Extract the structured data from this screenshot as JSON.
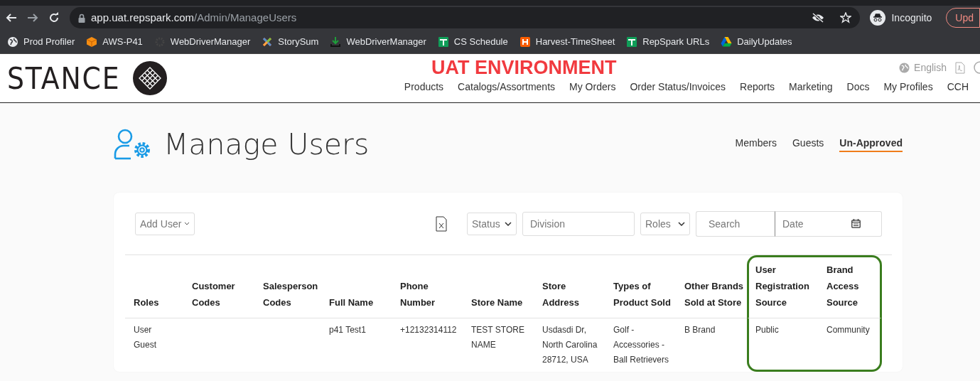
{
  "browser": {
    "url_host": "app.uat.repspark.com",
    "url_path": "/Admin/ManageUsers",
    "profile": "Incognito",
    "update_button": "Upd"
  },
  "bookmarks": [
    {
      "label": "Prod Profiler",
      "kind": "globe"
    },
    {
      "label": "AWS-P41",
      "kind": "cube"
    },
    {
      "label": "WebDriverManager",
      "kind": "gear"
    },
    {
      "label": "StorySum",
      "kind": "joomla"
    },
    {
      "label": "WebDriverManager",
      "kind": "download"
    },
    {
      "label": "CS Schedule",
      "kind": "sheet"
    },
    {
      "label": "Harvest-TimeSheet",
      "kind": "harvest"
    },
    {
      "label": "RepSpark URLs",
      "kind": "sheet"
    },
    {
      "label": "DailyUpdates",
      "kind": "drive"
    }
  ],
  "header": {
    "logo": "STANCE",
    "environment": "UAT ENVIRONMENT",
    "language": "English",
    "nav": [
      "Products",
      "Catalogs/Assortments",
      "My Orders",
      "Order Status/Invoices",
      "Reports",
      "Marketing",
      "Docs",
      "My Profiles",
      "CCH"
    ]
  },
  "page": {
    "title": "Manage Users",
    "tabs": [
      {
        "label": "Members",
        "selected": false
      },
      {
        "label": "Guests",
        "selected": false
      },
      {
        "label": "Un-Approved",
        "selected": true
      }
    ]
  },
  "filters": {
    "add_user": "Add User",
    "status": "Status",
    "division": {
      "placeholder": "Division"
    },
    "roles": "Roles",
    "search": {
      "placeholder": "Search"
    },
    "date": {
      "placeholder": "Date"
    }
  },
  "table": {
    "columns": [
      {
        "label": "Roles",
        "highlighted": false
      },
      {
        "label": "Customer\nCodes",
        "highlighted": false
      },
      {
        "label": "Salesperson\nCodes",
        "highlighted": false
      },
      {
        "label": "Full Name",
        "highlighted": false
      },
      {
        "label": "Phone\nNumber",
        "highlighted": false
      },
      {
        "label": "Store Name",
        "highlighted": false
      },
      {
        "label": "Store\nAddress",
        "highlighted": false
      },
      {
        "label": "Types of\nProduct Sold",
        "highlighted": false
      },
      {
        "label": "Other Brands\nSold at Store",
        "highlighted": false
      },
      {
        "label": "User\nRegistration\nSource",
        "highlighted": true
      },
      {
        "label": "Brand\nAccess\nSource",
        "highlighted": true
      }
    ],
    "rows": [
      [
        "User\nGuest",
        "",
        "",
        "p41 Test1",
        "+12132314112",
        "TEST STORE\nNAME",
        "Usdasdi Dr,\nNorth Carolina\n28712, USA",
        "Golf -\nAccessories -\nBall Retrievers",
        "B Brand",
        "Public",
        "Community"
      ]
    ]
  }
}
